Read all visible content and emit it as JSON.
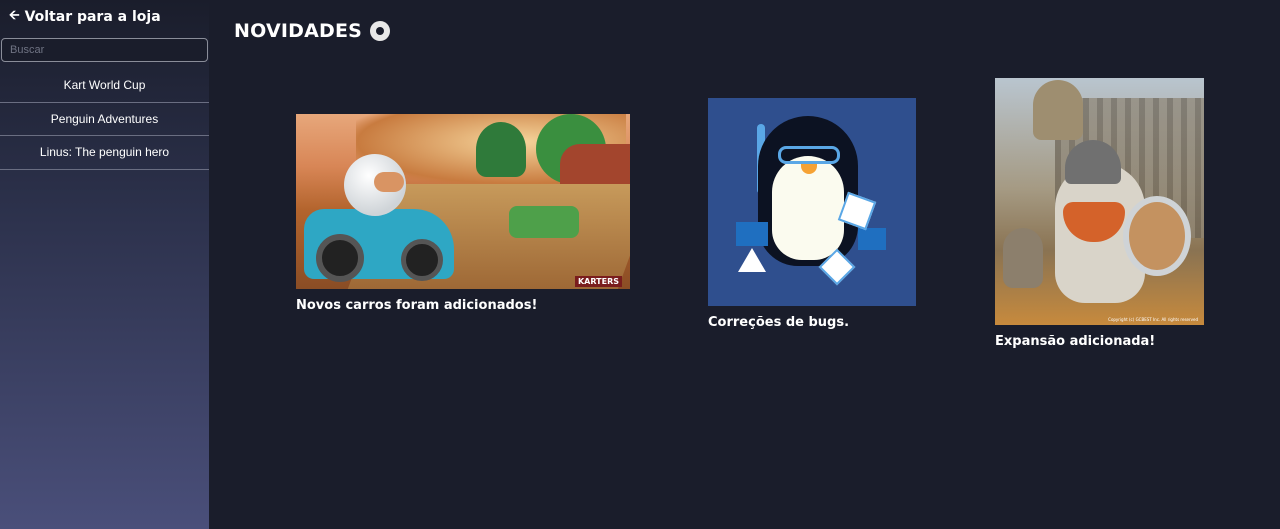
{
  "sidebar": {
    "back_label": "Voltar para a loja",
    "search_placeholder": "Buscar",
    "games": [
      {
        "label": "Kart World Cup"
      },
      {
        "label": "Penguin Adventures"
      },
      {
        "label": "Linus: The penguin hero"
      }
    ]
  },
  "main": {
    "title": "NOVIDADES",
    "news": [
      {
        "caption": "Novos carros foram adicionados!",
        "image_text": "KARTERS"
      },
      {
        "caption": "Correções de bugs."
      },
      {
        "caption": "Expansão adicionada!",
        "image_text": "Copyright (c) GCBEST Inc. All rights reserved"
      }
    ]
  },
  "icons": {
    "back": "arrow-left-icon",
    "settings": "gear-icon"
  }
}
